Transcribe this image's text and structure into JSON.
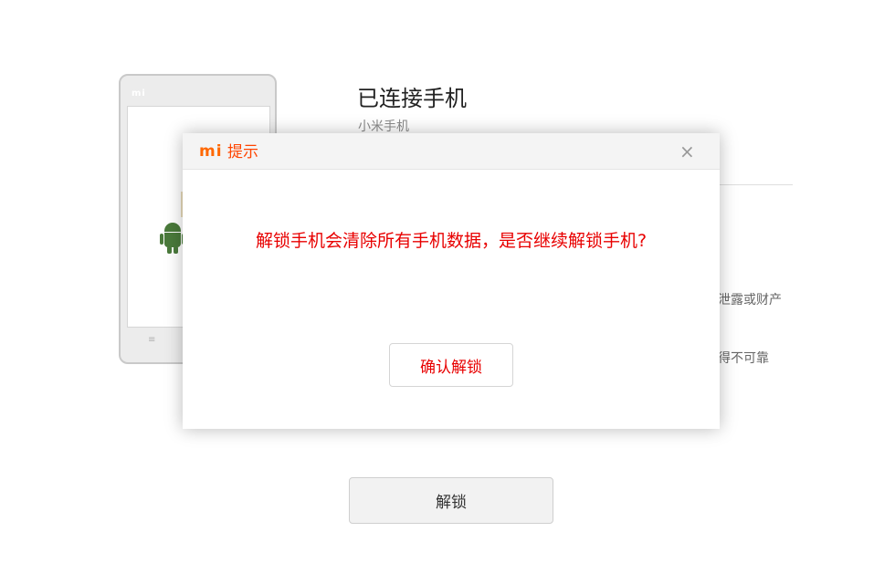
{
  "phone": {
    "brand": "mi",
    "menu_glyph": "≡"
  },
  "connection": {
    "title": "已连接手机",
    "subtitle": "小米手机"
  },
  "info": {
    "line1": "泄露或财产",
    "line2": "得不可靠"
  },
  "unlock_button": {
    "label": "解锁"
  },
  "dialog": {
    "logo": "mi",
    "title": "提示",
    "close_icon": "×",
    "message": "解锁手机会清除所有手机数据，是否继续解锁手机?",
    "confirm_label": "确认解锁"
  },
  "colors": {
    "accent": "#ff6700",
    "warning_text": "#e80000"
  }
}
